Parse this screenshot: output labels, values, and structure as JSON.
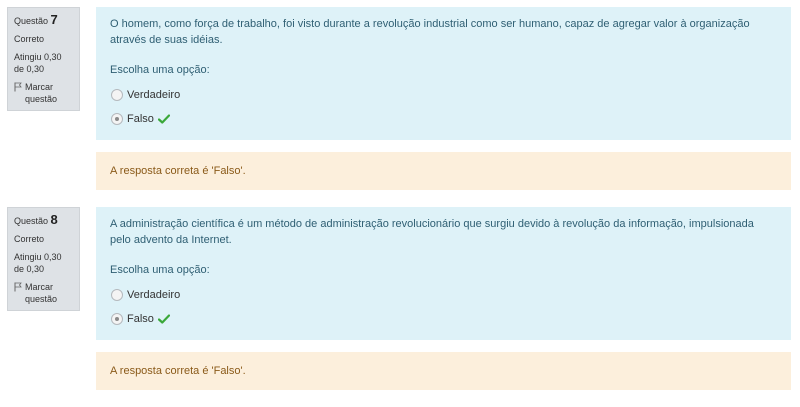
{
  "questions": [
    {
      "label": "Questão",
      "number": "7",
      "state": "Correto",
      "grade": "Atingiu 0,30 de 0,30",
      "flag_label": "Marcar questão",
      "text": "O homem, como força de trabalho, foi visto durante a revolução industrial como ser humano, capaz de agregar valor à organização através de suas idéias.",
      "prompt": "Escolha uma opção:",
      "options": [
        {
          "label": "Verdadeiro",
          "selected": false,
          "correct": false
        },
        {
          "label": "Falso",
          "selected": true,
          "correct": true
        }
      ],
      "feedback": "A resposta correta é 'Falso'."
    },
    {
      "label": "Questão",
      "number": "8",
      "state": "Correto",
      "grade": "Atingiu 0,30 de 0,30",
      "flag_label": "Marcar questão",
      "text": "A administração científica é um método de administração revolucionário que surgiu devido à revolução da informação, impulsionada pelo advento da Internet.",
      "prompt": "Escolha uma opção:",
      "options": [
        {
          "label": "Verdadeiro",
          "selected": false,
          "correct": false
        },
        {
          "label": "Falso",
          "selected": true,
          "correct": true
        }
      ],
      "feedback": "A resposta correta é 'Falso'."
    }
  ],
  "colors": {
    "info_bg": "#dee2e6",
    "formulation_bg": "#def2f8",
    "feedback_bg": "#fcefdc",
    "check_green": "#3aa83a"
  }
}
